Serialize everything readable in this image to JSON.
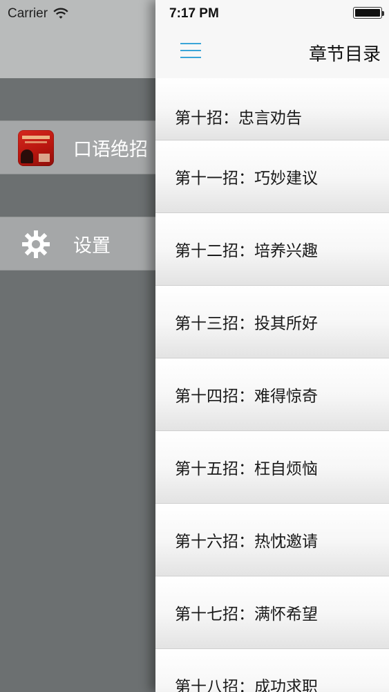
{
  "drawer": {
    "carrier": "Carrier",
    "items": [
      {
        "label": "口语绝招",
        "icon": "app-logo-icon"
      },
      {
        "label": "设置",
        "icon": "gear-icon"
      }
    ]
  },
  "status_bar": {
    "time": "7:17 PM"
  },
  "navbar": {
    "title": "章节目录",
    "menu_icon": "hamburger-menu-icon",
    "accent_color": "#3aa5d8"
  },
  "chapters": [
    "第十招：忠言劝告",
    "第十一招：巧妙建议",
    "第十二招：培养兴趣",
    "第十三招：投其所好",
    "第十四招：难得惊奇",
    "第十五招：枉自烦恼",
    "第十六招：热忱邀请",
    "第十七招：满怀希望",
    "第十八招：成功求职"
  ]
}
